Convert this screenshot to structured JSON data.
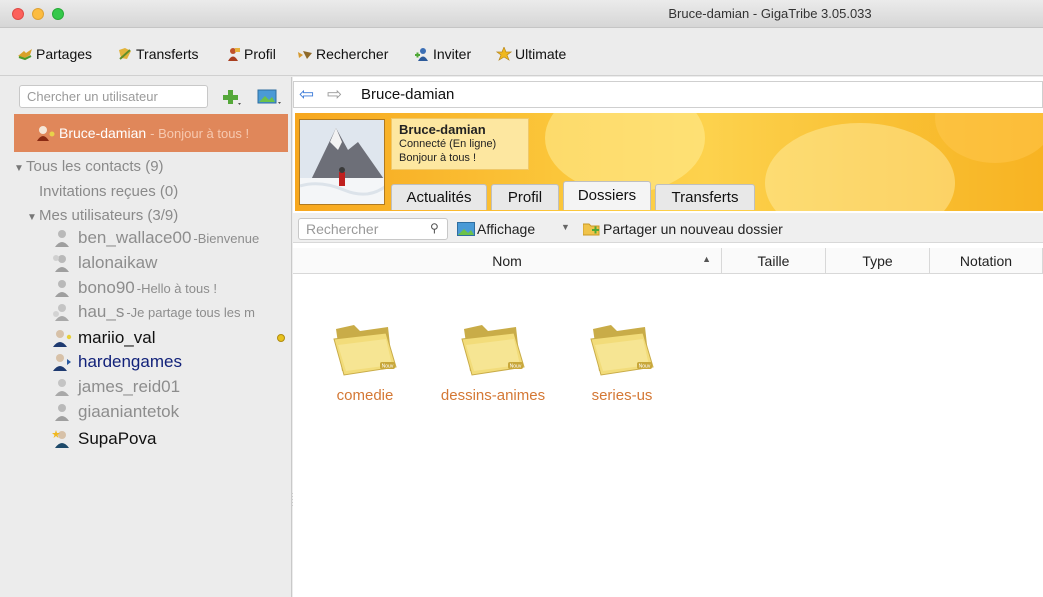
{
  "window": {
    "title": "Bruce-damian - GigaTribe 3.05.033"
  },
  "toolbar": {
    "items": [
      {
        "label": "Partages",
        "icon": "share-icon"
      },
      {
        "label": "Transferts",
        "icon": "transfer-icon"
      },
      {
        "label": "Profil",
        "icon": "profile-icon"
      },
      {
        "label": "Rechercher",
        "icon": "search-icon"
      },
      {
        "label": "Inviter",
        "icon": "invite-icon"
      },
      {
        "label": "Ultimate",
        "icon": "star-icon"
      }
    ]
  },
  "sidebar": {
    "search_placeholder": "Chercher un utilisateur",
    "self": {
      "name": "Bruce-damian",
      "status": "- Bonjour à tous !"
    },
    "all_contacts": "Tous les contacts (9)",
    "invitations": "Invitations reçues (0)",
    "my_users": "Mes utilisateurs (3/9)",
    "contacts": [
      {
        "name": "ben_wallace00",
        "status": "-Bienvenue",
        "state": "offline"
      },
      {
        "name": "lalonaikaw",
        "status": "",
        "state": "offline"
      },
      {
        "name": "bono90",
        "status": "-Hello à tous !",
        "state": "offline"
      },
      {
        "name": "hau_s",
        "status": "-Je partage tous les m",
        "state": "offline"
      },
      {
        "name": "mariio_val",
        "status": "",
        "state": "online"
      },
      {
        "name": "hardengames",
        "status": "",
        "state": "online-blue"
      },
      {
        "name": "james_reid01",
        "status": "",
        "state": "offline"
      },
      {
        "name": "giaaniantetok",
        "status": "",
        "state": "offline"
      },
      {
        "name": "SupaPova",
        "status": "",
        "state": "online"
      }
    ]
  },
  "nav": {
    "current": "Bruce-damian"
  },
  "profile": {
    "name": "Bruce-damian",
    "status": "Connecté (En ligne)",
    "message": "Bonjour à tous !"
  },
  "tabs": [
    "Actualités",
    "Profil",
    "Dossiers",
    "Transferts"
  ],
  "active_tab": "Dossiers",
  "folderbar": {
    "search_placeholder": "Rechercher",
    "view_label": "Affichage",
    "share_label": "Partager un nouveau dossier"
  },
  "columns": [
    "Nom",
    "Taille",
    "Type",
    "Notation"
  ],
  "folders": [
    {
      "name": "comedie",
      "badge": "Nouv"
    },
    {
      "name": "dessins-animes",
      "badge": "Nouv"
    },
    {
      "name": "series-us",
      "badge": "Nouv"
    }
  ],
  "colors": {
    "selection": "#e0875a",
    "folder_label": "#d47835",
    "banner": "#fbc63a"
  }
}
